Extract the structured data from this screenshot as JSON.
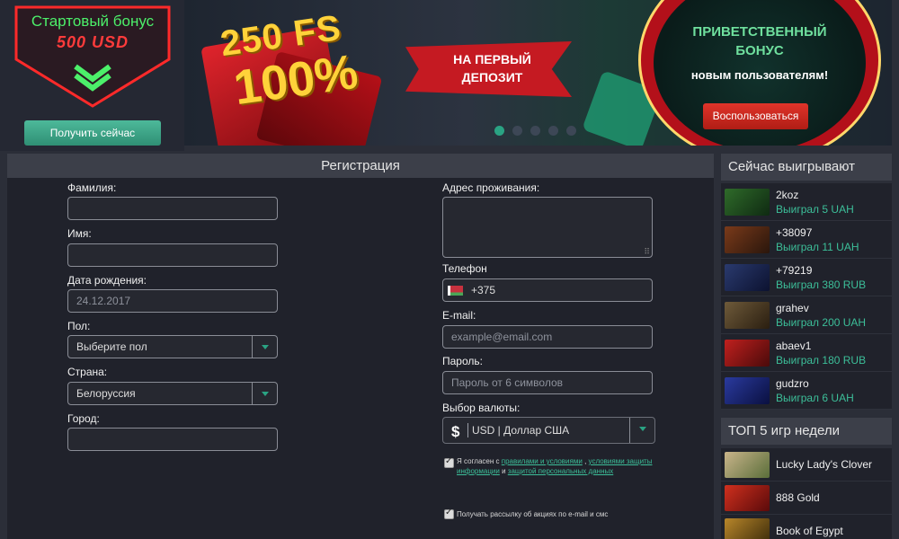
{
  "bonus": {
    "title": "Стартовый бонус",
    "amount": "500 USD",
    "button": "Получить сейчас"
  },
  "banner": {
    "free_spins": "250 FS",
    "percent": "100%",
    "ribbon_line1": "НА ПЕРВЫЙ",
    "ribbon_line2": "ДЕПОЗИТ",
    "welcome_line1": "ПРИВЕТСТВЕННЫЙ",
    "welcome_line2": "БОНУС",
    "welcome_sub": "новым пользователям!",
    "button": "Воспользоваться",
    "slides": 5,
    "active_slide": 1
  },
  "registration": {
    "title": "Регистрация",
    "surname_label": "Фамилия:",
    "name_label": "Имя:",
    "birthdate_label": "Дата рождения:",
    "birthdate_value": "24.12.2017",
    "gender_label": "Пол:",
    "gender_value": "Выберите пол",
    "country_label": "Страна:",
    "country_value": "Белоруссия",
    "city_label": "Город:",
    "address_label": "Адрес проживания:",
    "phone_label": "Телефон",
    "phone_value": "+375",
    "email_label": "E-mail:",
    "email_placeholder": "example@email.com",
    "password_label": "Пароль:",
    "password_placeholder": "Пароль от 6 символов",
    "currency_label": "Выбор валюты:",
    "currency_sign": "$",
    "currency_value": "USD | Доллар США",
    "agree_prefix": "Я согласен с",
    "agree_link1": "правилами и условиями",
    "agree_sep": ",",
    "agree_link2": "условиями защиты информации",
    "agree_and": "и",
    "agree_link3": "защитой персональных данных",
    "newsletter_label": "Получать рассылку об акциях по e-mail и смс"
  },
  "winners": {
    "title": "Сейчас выигрывают",
    "items": [
      {
        "name": "2koz",
        "amount": "Выиграл 5 UAH"
      },
      {
        "name": "+38097",
        "amount": "Выиграл 11 UAH"
      },
      {
        "name": "+79219",
        "amount": "Выиграл 380 RUB"
      },
      {
        "name": "grahev",
        "amount": "Выиграл 200 UAH"
      },
      {
        "name": "abaev1",
        "amount": "Выиграл 180 RUB"
      },
      {
        "name": "gudzro",
        "amount": "Выиграл 6 UAH"
      }
    ]
  },
  "top_games": {
    "title": "ТОП 5 игр недели",
    "items": [
      {
        "name": "Lucky Lady's Clover"
      },
      {
        "name": "888 Gold"
      },
      {
        "name": "Book of Egypt"
      }
    ]
  },
  "colors": {
    "accent": "#2aa383",
    "win_text": "#3cbf99",
    "bonus_green": "#4cf06a",
    "bonus_red": "#ff3b3b"
  }
}
